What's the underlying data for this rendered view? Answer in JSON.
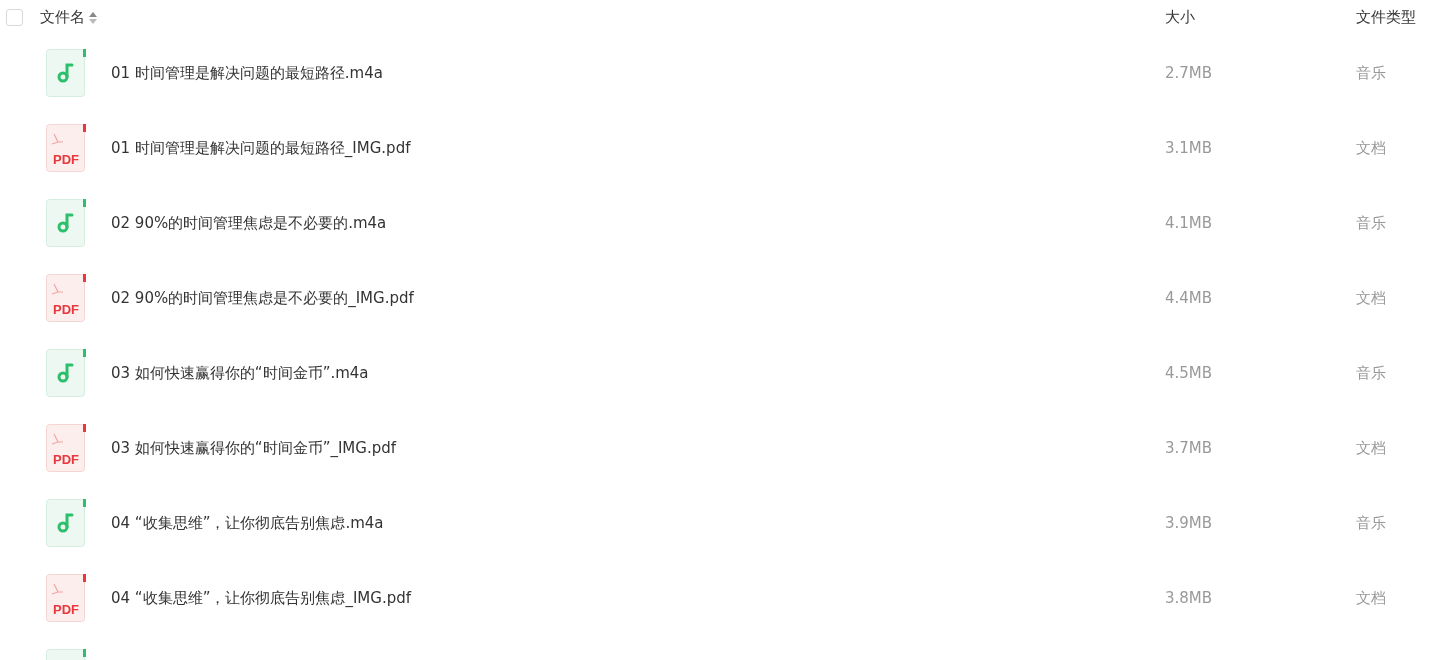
{
  "header": {
    "checked": false,
    "columns": [
      "文件名",
      "大小",
      "文件类型"
    ]
  },
  "rows": [
    {
      "kind": "audio",
      "name": "01 时间管理是解决问题的最短路径.m4a",
      "size": "2.7MB",
      "type": "音乐"
    },
    {
      "kind": "pdf",
      "icon_label": "PDF",
      "name": "01 时间管理是解决问题的最短路径_IMG.pdf",
      "size": "3.1MB",
      "type": "文档"
    },
    {
      "kind": "audio",
      "name": "02 90%的时间管理焦虑是不必要的.m4a",
      "size": "4.1MB",
      "type": "音乐"
    },
    {
      "kind": "pdf",
      "icon_label": "PDF",
      "name": "02 90%的时间管理焦虑是不必要的_IMG.pdf",
      "size": "4.4MB",
      "type": "文档"
    },
    {
      "kind": "audio",
      "name": "03 如何快速赢得你的“时间金币”.m4a",
      "size": "4.5MB",
      "type": "音乐"
    },
    {
      "kind": "pdf",
      "icon_label": "PDF",
      "name": "03 如何快速赢得你的“时间金币”_IMG.pdf",
      "size": "3.7MB",
      "type": "文档"
    },
    {
      "kind": "audio",
      "name": "04 “收集思维”，让你彻底告别焦虑.m4a",
      "size": "3.9MB",
      "type": "音乐"
    },
    {
      "kind": "pdf",
      "icon_label": "PDF",
      "name": "04 “收集思维”，让你彻底告别焦虑_IMG.pdf",
      "size": "3.8MB",
      "type": "文档"
    },
    {
      "kind": "audio"
    }
  ]
}
